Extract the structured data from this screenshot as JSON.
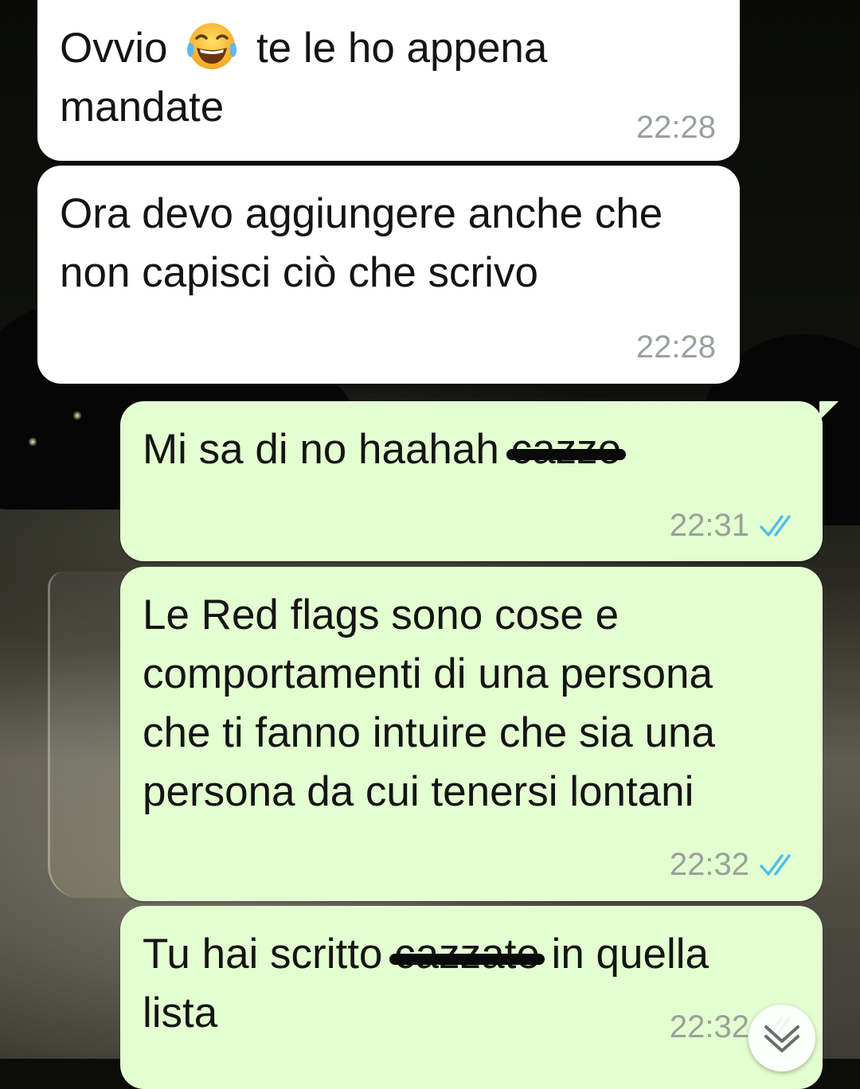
{
  "messages": [
    {
      "side": "incoming",
      "text_before": "Ovvio",
      "emoji": "tears-of-joy-emoji",
      "text_after": "te le ho appena mandate",
      "time": "22:28"
    },
    {
      "side": "incoming",
      "text": "Ora devo aggiungere anche che non capisci ciò che scrivo",
      "time": "22:28"
    },
    {
      "side": "outgoing",
      "text": "Mi sa di no haahah",
      "struck_text": "cazzo",
      "time": "22:31",
      "status": "read-double-check-icon"
    },
    {
      "side": "outgoing",
      "text": "Le Red flags sono cose e comportamenti di una persona che ti fanno intuire che sia una persona da cui tenersi lontani",
      "time": "22:32",
      "status": "read-double-check-icon"
    },
    {
      "side": "outgoing",
      "text_before": "Tu hai scritto",
      "struck_text": "cazzate",
      "text_after": "in quella lista",
      "time": "22:32",
      "status": "read-double-check-icon"
    }
  ],
  "colors": {
    "incoming_bubble": "#ffffff",
    "outgoing_bubble": "#e3fed0",
    "read_ticks": "#53bdeb",
    "timestamp": "#9aa19a"
  },
  "scroll_button": {
    "icon": "chevron-down-icon"
  }
}
